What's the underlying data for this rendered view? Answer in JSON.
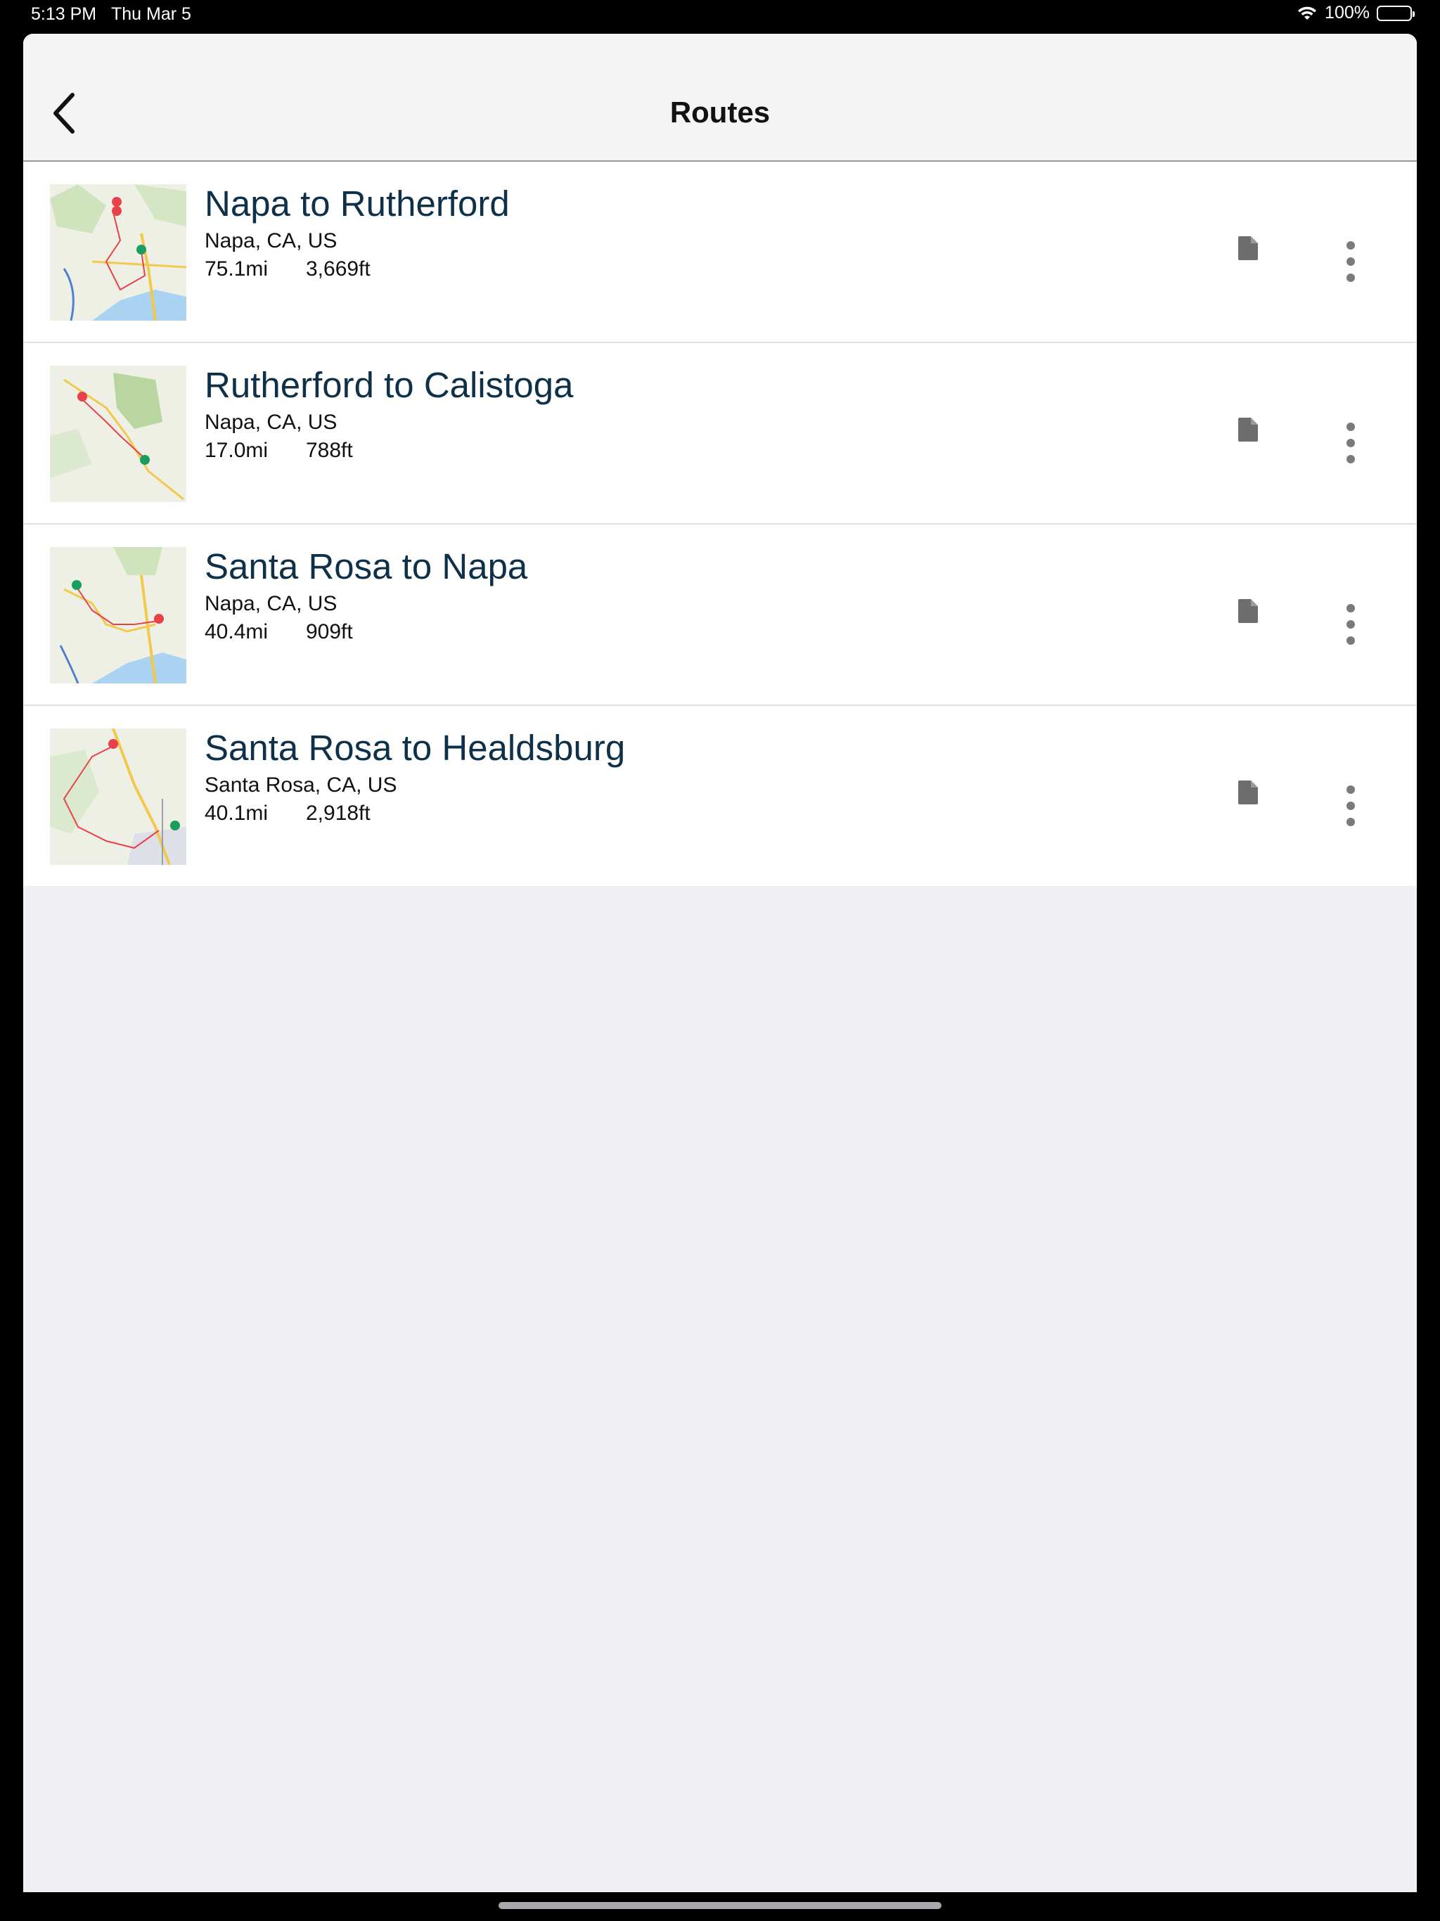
{
  "status_bar": {
    "time": "5:13 PM",
    "date": "Thu Mar 5",
    "battery": "100%",
    "wifi_icon": "wifi-icon",
    "battery_icon": "battery-icon"
  },
  "nav": {
    "title": "Routes",
    "back_icon": "chevron-left-icon"
  },
  "routes": [
    {
      "title": "Napa to Rutherford",
      "location": "Napa, CA, US",
      "distance": "75.1mi",
      "elevation": "3,669ft",
      "doc_icon": "document-icon",
      "more_icon": "more-vertical-icon"
    },
    {
      "title": "Rutherford to Calistoga",
      "location": "Napa, CA, US",
      "distance": "17.0mi",
      "elevation": "788ft",
      "doc_icon": "document-icon",
      "more_icon": "more-vertical-icon"
    },
    {
      "title": "Santa Rosa to Napa",
      "location": "Napa, CA, US",
      "distance": "40.4mi",
      "elevation": "909ft",
      "doc_icon": "document-icon",
      "more_icon": "more-vertical-icon"
    },
    {
      "title": "Santa Rosa to Healdsburg",
      "location": "Santa Rosa, CA, US",
      "distance": "40.1mi",
      "elevation": "2,918ft",
      "doc_icon": "document-icon",
      "more_icon": "more-vertical-icon"
    }
  ],
  "colors": {
    "title_text": "#0e3149",
    "icon_gray": "#6d6d6d",
    "start_pin": "#1a9e5f",
    "end_pin": "#e8414a",
    "background": "#efeff4"
  }
}
